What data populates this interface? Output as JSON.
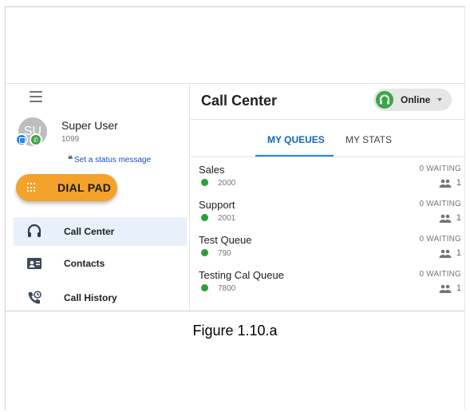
{
  "sidebar": {
    "user": {
      "initials": "SU",
      "name": "Super User",
      "extension": "1099",
      "status_quote": "❝",
      "status_link": "Set a status message"
    },
    "dialpad_label": "DIAL PAD",
    "nav": [
      {
        "label": "Call Center",
        "icon": "headset-icon",
        "active": true
      },
      {
        "label": "Contacts",
        "icon": "contact-card-icon",
        "active": false
      },
      {
        "label": "Call History",
        "icon": "phone-history-icon",
        "active": false
      }
    ]
  },
  "header": {
    "title": "Call Center",
    "status": "Online"
  },
  "tabs": [
    {
      "label": "MY QUEUES",
      "active": true
    },
    {
      "label": "MY STATS",
      "active": false
    }
  ],
  "queues": [
    {
      "name": "Sales",
      "extension": "2000",
      "waiting": "0 WAITING",
      "agents": "1"
    },
    {
      "name": "Support",
      "extension": "2001",
      "waiting": "0 WAITING",
      "agents": "1"
    },
    {
      "name": "Test Queue",
      "extension": "790",
      "waiting": "0 WAITING",
      "agents": "1"
    },
    {
      "name": "Testing Cal Queue",
      "extension": "7800",
      "waiting": "0 WAITING",
      "agents": "1"
    }
  ],
  "caption": "Figure 1.10.a",
  "colors": {
    "accent": "#1e88e5",
    "dialpad": "#f3a22c",
    "online": "#3aa648",
    "active_nav": "#e8f1fa"
  }
}
